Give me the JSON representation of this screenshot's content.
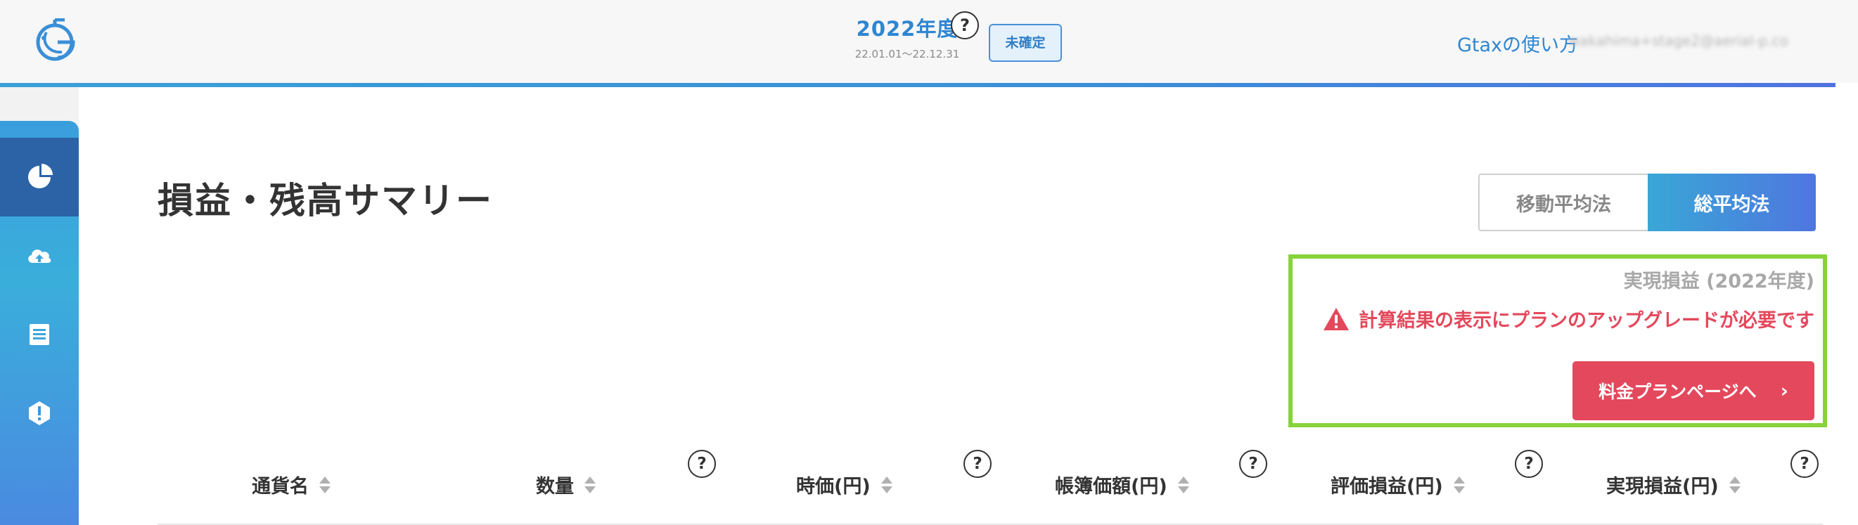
{
  "header": {
    "logo_icon": "gtax-logo-icon",
    "fiscal_year": "2022年度",
    "fiscal_range": "22.01.01〜22.12.31",
    "help_glyph": "?",
    "status_badge": "未確定",
    "howto_link": "Gtaxの使い方",
    "user_email": "wakahima+stage2@aerial-p.co"
  },
  "sidebar": {
    "items": [
      {
        "icon": "pie-chart-icon",
        "active": true
      },
      {
        "icon": "cloud-upload-icon",
        "active": false
      },
      {
        "icon": "document-icon",
        "active": false
      },
      {
        "icon": "alert-icon",
        "active": false
      }
    ]
  },
  "main": {
    "title": "損益・残高サマリー",
    "method_toggle": {
      "options": [
        "移動平均法",
        "総平均法"
      ],
      "selected": "総平均法"
    },
    "notice": {
      "heading": "実現損益 (2022年度)",
      "warning": "計算結果の表示にプランのアップグレードが必要です",
      "button_label": "料金プランページへ",
      "button_chevron": "›"
    },
    "table": {
      "columns": [
        {
          "label": "通貨名",
          "help": false
        },
        {
          "label": "数量",
          "help": true
        },
        {
          "label": "時価(円)",
          "help": true
        },
        {
          "label": "帳簿価額(円)",
          "help": true
        },
        {
          "label": "評価損益(円)",
          "help": true
        },
        {
          "label": "実現損益(円)",
          "help": true
        }
      ],
      "help_glyph": "?"
    }
  },
  "colors": {
    "accent_blue": "#2f86d1",
    "warning_red": "#e4485c",
    "highlight_green": "#86d33a"
  }
}
